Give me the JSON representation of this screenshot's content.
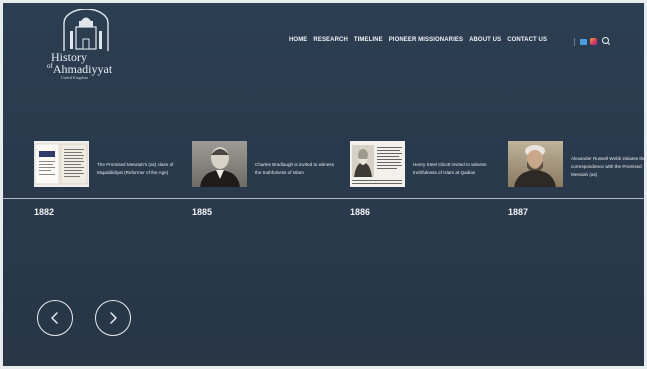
{
  "brand": {
    "line1": "History",
    "line2_prefix": "of",
    "line2": "Ahmadiyyat",
    "line3": "United Kingdom"
  },
  "nav": {
    "items": [
      "HOME",
      "RESEARCH",
      "TIMELINE",
      "PIONEER MISSIONARIES",
      "ABOUT US",
      "CONTACT US"
    ],
    "social_icons": [
      "twitter-icon",
      "instagram-icon"
    ],
    "search_icon": "search-icon"
  },
  "timeline": {
    "items": [
      {
        "year": "1882",
        "caption": "The Promised Messiah's (as) claim of Mujaddidiyat (Reformer of the Age)",
        "image": "book-cover-photo"
      },
      {
        "year": "1885",
        "caption": "Charles Bradlaugh is invited to witness the truthfulness of Islam",
        "image": "charles-bradlaugh-portrait"
      },
      {
        "year": "1886",
        "caption": "Henry Steel Olcott invited to witness truthfulness of Islam at Qadian",
        "image": "henry-olcott-newspaper"
      },
      {
        "year": "1887",
        "caption": "Alexander Russell Webb initiates the correspondence with the Promised Messiah (as)",
        "image": "alexander-webb-portrait"
      }
    ]
  },
  "controls": {
    "prev_icon": "chevron-left-icon",
    "next_icon": "chevron-right-icon"
  },
  "colors": {
    "background": "#2a3a4d",
    "text": "#f0f3f5",
    "timeline_line": "#aeb9c4"
  }
}
